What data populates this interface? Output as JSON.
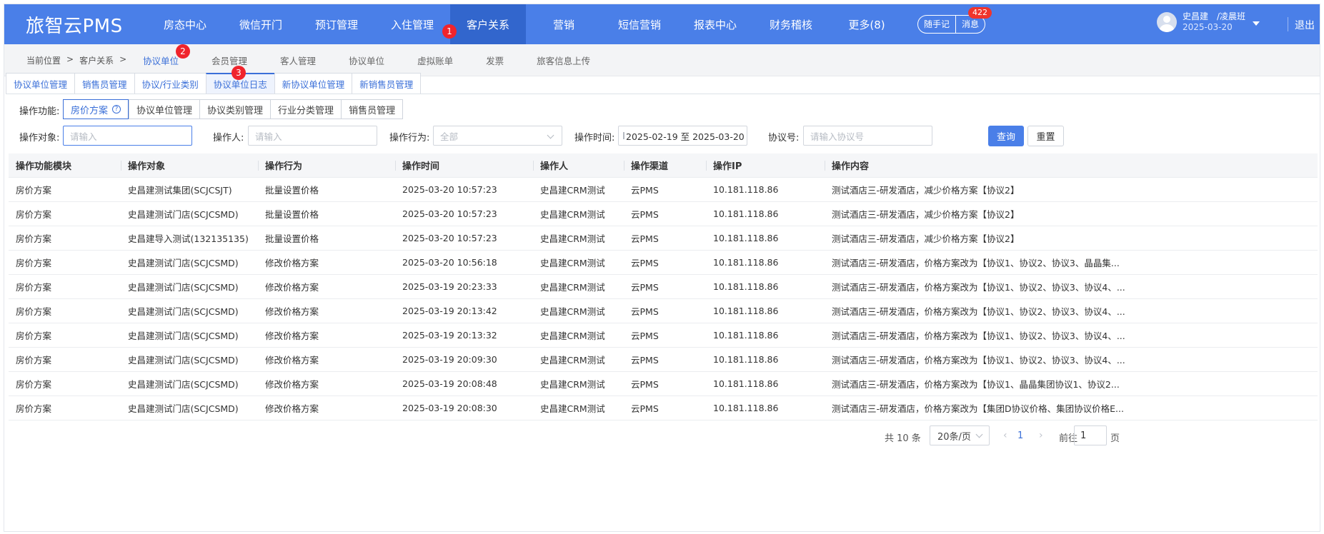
{
  "brand": "旅智云PMS",
  "nav": {
    "items": [
      "房态中心",
      "微信开门",
      "预订管理",
      "入住管理",
      "客户关系",
      "营销",
      "短信营销",
      "报表中心",
      "财务稽核",
      "更多(8)"
    ],
    "active_index": 4,
    "memo_label": "随手记",
    "msg_label": "消息",
    "msg_count": "422",
    "user_name": "史昌建　/凌晨班",
    "user_date": "2025-03-20",
    "logout": "退出"
  },
  "markers": [
    "1",
    "2",
    "3"
  ],
  "breadcrumb": [
    "当前位置",
    ">",
    "客户关系",
    ">"
  ],
  "subtabs": [
    "协议单位",
    "会员管理",
    "客人管理",
    "协议单位",
    "虚拟账单",
    "发票",
    "旅客信息上传"
  ],
  "tabs": [
    "协议单位管理",
    "销售员管理",
    "协议/行业类别",
    "协议单位日志",
    "新协议单位管理",
    "新销售员管理"
  ],
  "filters": {
    "function_label": "操作功能:",
    "functions": [
      "房价方案",
      "协议单位管理",
      "协议类别管理",
      "行业分类管理",
      "销售员管理"
    ],
    "object_label": "操作对象:",
    "object_placeholder": "请输入",
    "operator_label": "操作人:",
    "operator_placeholder": "请输入",
    "action_label": "操作行为:",
    "action_value": "全部",
    "time_label": "操作时间:",
    "time_value": "2025-02-19 至 2025-03-20",
    "agreement_label": "协议号:",
    "agreement_placeholder": "请输入协议号",
    "query": "查询",
    "reset": "重置"
  },
  "table": {
    "columns": [
      "操作功能模块",
      "操作对象",
      "操作行为",
      "操作时间",
      "操作人",
      "操作渠道",
      "操作IP",
      "操作内容"
    ],
    "rows": [
      [
        "房价方案",
        "史昌建测试集团(SCJCSJT)",
        "批量设置价格",
        "2025-03-20 10:57:23",
        "史昌建CRM测试",
        "云PMS",
        "10.181.118.86",
        "测试酒店三-研发酒店，减少价格方案【协议2】"
      ],
      [
        "房价方案",
        "史昌建测试门店(SCJCSMD)",
        "批量设置价格",
        "2025-03-20 10:57:23",
        "史昌建CRM测试",
        "云PMS",
        "10.181.118.86",
        "测试酒店三-研发酒店，减少价格方案【协议2】"
      ],
      [
        "房价方案",
        "史昌建导入测试(132135135)",
        "批量设置价格",
        "2025-03-20 10:57:23",
        "史昌建CRM测试",
        "云PMS",
        "10.181.118.86",
        "测试酒店三-研发酒店，减少价格方案【协议2】"
      ],
      [
        "房价方案",
        "史昌建测试门店(SCJCSMD)",
        "修改价格方案",
        "2025-03-20 10:56:18",
        "史昌建CRM测试",
        "云PMS",
        "10.181.118.86",
        "测试酒店三-研发酒店，价格方案改为【协议1、协议2、协议3、晶晶集..."
      ],
      [
        "房价方案",
        "史昌建测试门店(SCJCSMD)",
        "修改价格方案",
        "2025-03-19 20:23:33",
        "史昌建CRM测试",
        "云PMS",
        "10.181.118.86",
        "测试酒店三-研发酒店，价格方案改为【协议1、协议2、协议3、协议4、..."
      ],
      [
        "房价方案",
        "史昌建测试门店(SCJCSMD)",
        "修改价格方案",
        "2025-03-19 20:13:42",
        "史昌建CRM测试",
        "云PMS",
        "10.181.118.86",
        "测试酒店三-研发酒店，价格方案改为【协议1、协议2、协议3、协议4、..."
      ],
      [
        "房价方案",
        "史昌建测试门店(SCJCSMD)",
        "修改价格方案",
        "2025-03-19 20:13:32",
        "史昌建CRM测试",
        "云PMS",
        "10.181.118.86",
        "测试酒店三-研发酒店，价格方案改为【协议1、协议2、协议3、协议4、..."
      ],
      [
        "房价方案",
        "史昌建测试门店(SCJCSMD)",
        "修改价格方案",
        "2025-03-19 20:09:30",
        "史昌建CRM测试",
        "云PMS",
        "10.181.118.86",
        "测试酒店三-研发酒店，价格方案改为【协议1、协议2、协议3、协议4、..."
      ],
      [
        "房价方案",
        "史昌建测试门店(SCJCSMD)",
        "修改价格方案",
        "2025-03-19 20:08:48",
        "史昌建CRM测试",
        "云PMS",
        "10.181.118.86",
        "测试酒店三-研发酒店，价格方案改为【协议1、晶晶集团协议1、协议2..."
      ],
      [
        "房价方案",
        "史昌建测试门店(SCJCSMD)",
        "修改价格方案",
        "2025-03-19 20:08:30",
        "史昌建CRM测试",
        "云PMS",
        "10.181.118.86",
        "测试酒店三-研发酒店，价格方案改为【集团D协议价格、集团协议价格E..."
      ]
    ]
  },
  "pagination": {
    "total": "共 10 条",
    "page_size": "20条/页",
    "current": "1",
    "goto_label": "前往",
    "goto_value": "1",
    "page_suffix": "页",
    "prev": "‹",
    "next": "›"
  }
}
